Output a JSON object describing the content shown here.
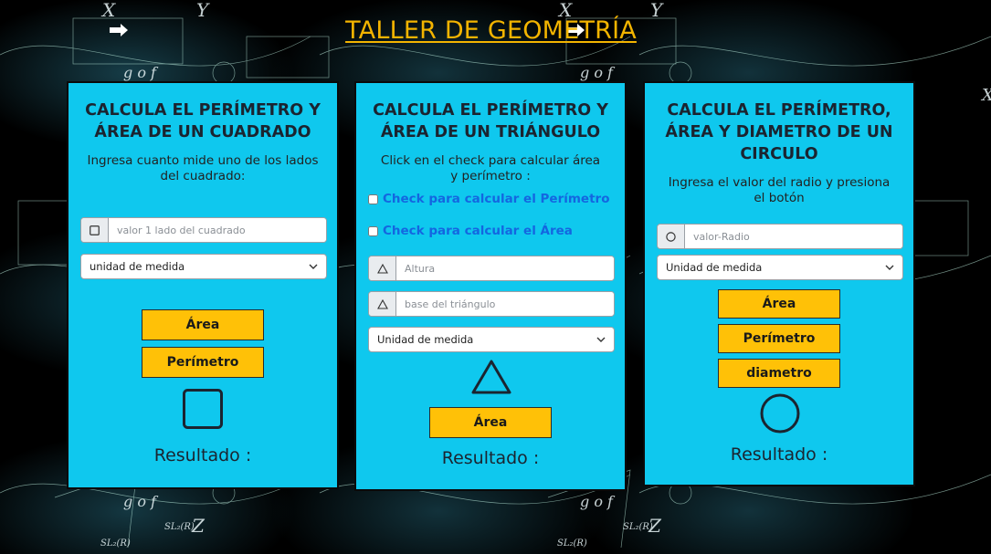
{
  "page": {
    "title": "TALLER DE GEOMETRÍA"
  },
  "square_card": {
    "heading": "CALCULA EL PERÍMETRO Y ÁREA DE UN CUADRADO",
    "instructions": "Ingresa cuanto mide uno de los lados del cuadrado:",
    "side_input": {
      "placeholder": "valor 1 lado del cuadrado",
      "value": "",
      "icon": "square-icon"
    },
    "unit_select": {
      "selected": "unidad de medida"
    },
    "area_button": "Área",
    "perimeter_button": "Perímetro",
    "shape_icon": "square-shape-icon",
    "result_label": "Resultado :"
  },
  "triangle_card": {
    "heading": "CALCULA EL PERÍMETRO Y ÁREA DE UN TRIÁNGULO",
    "instructions": "Click en el check para calcular área y perímetro :",
    "perimeter_check_label": "Check para calcular el Perímetro",
    "area_check_label": "Check para calcular el Área",
    "height_input": {
      "placeholder": "Altura",
      "value": "",
      "icon": "triangle-icon"
    },
    "base_input": {
      "placeholder": "base del triángulo",
      "value": "",
      "icon": "triangle-icon"
    },
    "unit_select": {
      "selected": "Unidad de medida"
    },
    "shape_icon": "triangle-shape-icon",
    "area_button": "Área",
    "result_label": "Resultado :"
  },
  "circle_card": {
    "heading": "CALCULA EL PERÍMETRO, ÁREA Y DIAMETRO DE UN CIRCULO",
    "instructions": "Ingresa el valor del radio y presiona el botón",
    "radius_input": {
      "placeholder": "valor-Radio",
      "value": "",
      "icon": "circle-icon"
    },
    "unit_select": {
      "selected": "Unidad de medida"
    },
    "area_button": "Área",
    "perimeter_button": "Perímetro",
    "diameter_button": "diametro",
    "shape_icon": "circle-shape-icon",
    "result_label": "Resultado :"
  },
  "colors": {
    "title": "#f3b400",
    "card_background": "#0fc8ee",
    "button_background": "#ffc107",
    "check_label": "#1466e0",
    "page_background": "#000000"
  }
}
